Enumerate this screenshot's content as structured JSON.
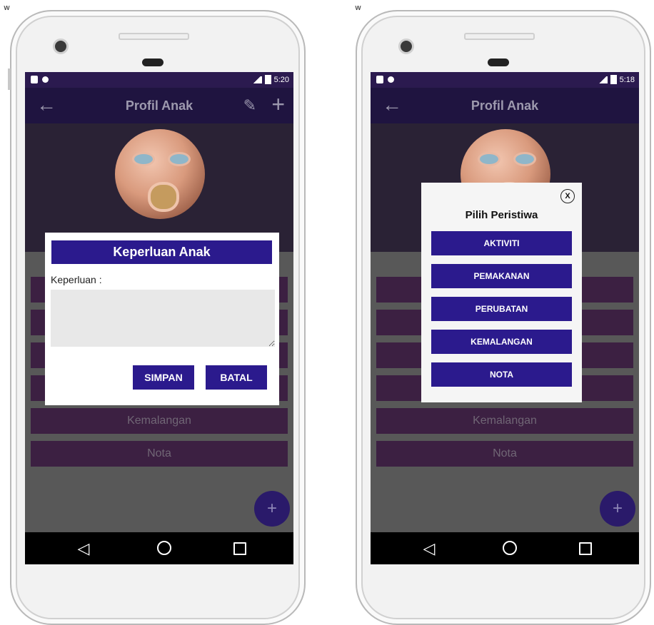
{
  "corner_mark": "w",
  "left_phone": {
    "status_time": "5:20",
    "app_title": "Profil Anak",
    "list_items": [
      "",
      "",
      "",
      "",
      "Kemalangan",
      "Nota"
    ],
    "fab_label": "+",
    "dialog": {
      "title": "Keperluan Anak",
      "field_label": "Keperluan :",
      "field_value": "",
      "save_label": "SIMPAN",
      "cancel_label": "BATAL"
    }
  },
  "right_phone": {
    "status_time": "5:18",
    "app_title": "Profil Anak",
    "list_items": [
      "",
      "",
      "",
      "",
      "Kemalangan",
      "Nota"
    ],
    "fab_label": "+",
    "dialog": {
      "close_label": "X",
      "title": "Pilih Peristiwa",
      "options": [
        "AKTIVITI",
        "PEMAKANAN",
        "PERUBATAN",
        "KEMALANGAN",
        "NOTA"
      ]
    }
  },
  "nav": {
    "back": "◁",
    "home_icon": "circle",
    "recents_icon": "square"
  },
  "colors": {
    "primary": "#2b1a8d",
    "appbar": "#1f1440",
    "list_item": "#3c2042"
  }
}
